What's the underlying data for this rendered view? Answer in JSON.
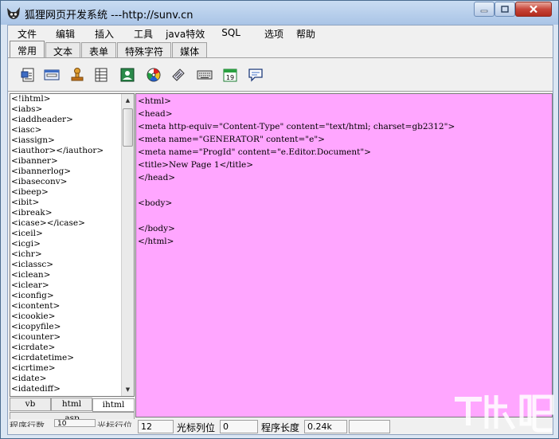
{
  "window": {
    "title": "狐狸网页开发系统 ---http://sunv.cn",
    "controls": {
      "minimize_icon": "minimize-icon",
      "maximize_icon": "maximize-icon",
      "close_icon": "close-icon"
    }
  },
  "menu": [
    "文件",
    "编辑",
    "插入",
    "工具",
    "java特效",
    "SQL",
    "选项",
    "帮助"
  ],
  "tabs": [
    "常用",
    "文本",
    "表单",
    "特殊字符",
    "媒体"
  ],
  "toolbar": {
    "icons": [
      "page-icon",
      "form-icon",
      "stamp-icon",
      "table-icon",
      "image-icon",
      "color-wheel-icon",
      "link-icon",
      "keyboard-icon",
      "calendar-icon",
      "comment-icon"
    ],
    "calendar_number": "19"
  },
  "tag_list": [
    "<!ihtml>",
    "<iabs>",
    "<iaddheader>",
    "<iasc>",
    "<iassign>",
    "<iauthor></iauthor>",
    "<ibanner>",
    "<ibannerlog>",
    "<ibaseconv>",
    "<ibeep>",
    "<ibit>",
    "<ibreak>",
    "<icase></icase>",
    "<iceil>",
    "<icgi>",
    "<ichr>",
    "<iclassc>",
    "<iclean>",
    "<iclear>",
    "<iconfig>",
    "<icontent>",
    "<icookie>",
    "<icopyfile>",
    "<icounter>",
    "<icrdate>",
    "<icrdatetime>",
    "<icrtime>",
    "<idate>",
    "<idatediff>"
  ],
  "bottom_tabs": {
    "vb": "vb",
    "html": "html",
    "ihtml": "ihtml",
    "asp": "asp"
  },
  "editor": {
    "background": "#ffa6ff",
    "lines": [
      "<html>",
      "<head>",
      "<meta http-equiv=\"Content-Type\" content=\"text/html; charset=gb2312\">",
      "<meta name=\"GENERATOR\" content=\"e\">",
      "<meta name=\"ProgId\" content=\"e.Editor.Document\">",
      "<title>New Page 1</title>",
      "</head>",
      "",
      "<body>",
      "",
      "</body>",
      "</html>"
    ]
  },
  "status": {
    "row_label_partial": "程序行数",
    "row_value": "10",
    "cursor_row_label_partial": "光标行位",
    "cursor_row_value": "12",
    "cursor_col_label": "光标列位",
    "cursor_col_value": "0",
    "length_label": "程序长度",
    "length_value": "0.24k",
    "extra_value": ""
  },
  "watermark_text": "下载吧"
}
